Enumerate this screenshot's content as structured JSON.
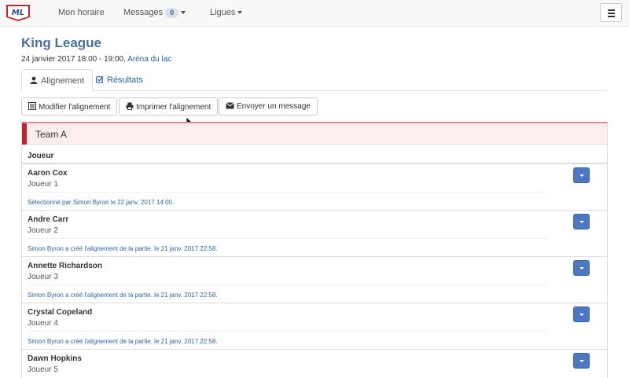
{
  "navbar": {
    "logo_text": "ML",
    "links": [
      {
        "label": "Mon horaire"
      },
      {
        "label": "Messages",
        "badge": "0"
      },
      {
        "label": "Ligues"
      }
    ]
  },
  "header": {
    "title": "King League",
    "datetime": "24 janvier 2017 18:00 - 19:00,",
    "venue": "Aréna du lac"
  },
  "tabs": [
    {
      "label": "Alignement",
      "icon": "user-icon",
      "active": true
    },
    {
      "label": "Résultats",
      "icon": "checkbox-edit-icon",
      "active": false
    }
  ],
  "actions": [
    {
      "label": "Modifier l'alignement",
      "icon": "list-icon"
    },
    {
      "label": "Imprimer l'alignement",
      "icon": "print-icon"
    },
    {
      "label": "Envoyer un message",
      "icon": "envelope-icon"
    }
  ],
  "team": {
    "name": "Team A",
    "accent": "#c9202f",
    "column_header": "Joueur",
    "players": [
      {
        "name": "Aaron Cox",
        "role": "Joueur 1",
        "note": "Sélectionné par Simon Byron le 22 janv. 2017 14:00."
      },
      {
        "name": "Andre Carr",
        "role": "Joueur 2",
        "note": "Simon Byron a créé l'alignement de la partie. le 21 janv. 2017 22:58."
      },
      {
        "name": "Annette Richardson",
        "role": "Joueur 3",
        "note": "Simon Byron a créé l'alignement de la partie. le 21 janv. 2017 22:58."
      },
      {
        "name": "Crystal Copeland",
        "role": "Joueur 4",
        "note": "Simon Byron a créé l'alignement de la partie. le 21 janv. 2017 22:58."
      },
      {
        "name": "Dawn Hopkins",
        "role": "Joueur 5",
        "note": ""
      }
    ]
  },
  "colors": {
    "link": "#2e63a8",
    "title": "#4a6fa5",
    "button_primary": "#4a78c2"
  }
}
